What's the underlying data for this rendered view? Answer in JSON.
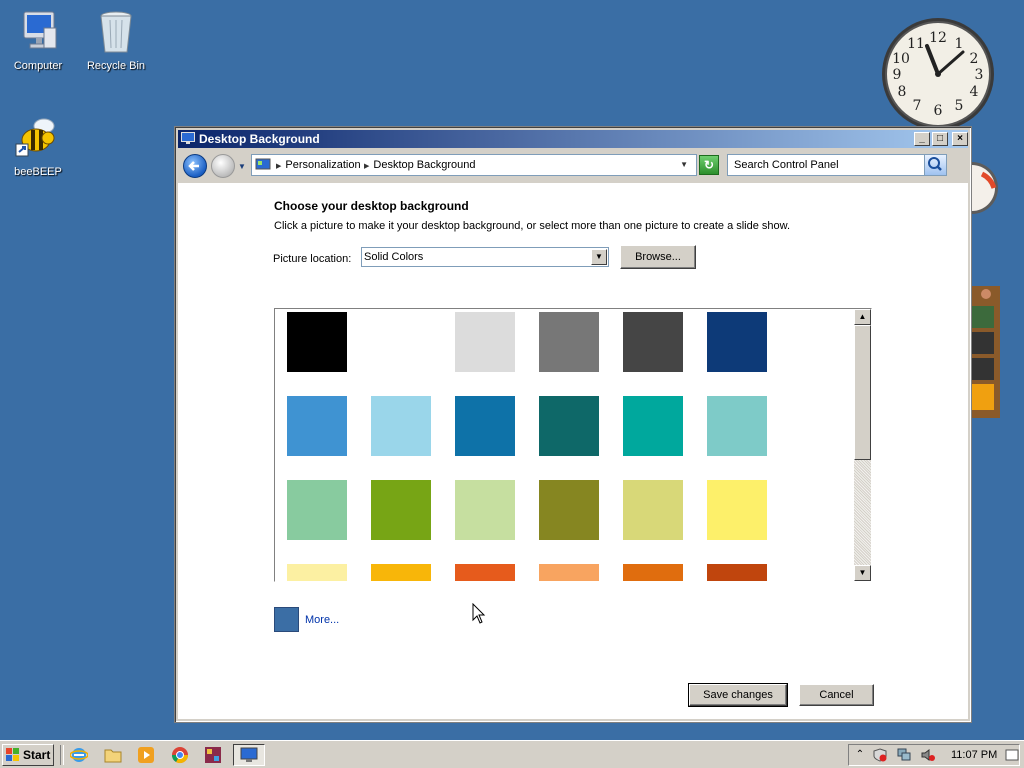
{
  "desktop": {
    "icons": [
      {
        "label": "Computer"
      },
      {
        "label": "Recycle Bin"
      },
      {
        "label": "beeBEEP"
      }
    ],
    "background_color": "#3a6ea5"
  },
  "clock_gadget": {
    "numbers": [
      "12",
      "1",
      "2",
      "3",
      "4",
      "5",
      "6",
      "7",
      "8",
      "9",
      "10",
      "11"
    ]
  },
  "window": {
    "title": "Desktop Background",
    "address": {
      "crumbs": [
        "Personalization",
        "Desktop Background"
      ]
    },
    "search": {
      "placeholder": "Search Control Panel"
    },
    "heading": "Choose your desktop background",
    "instructions": "Click a picture to make it your desktop background, or select more than one picture to create a slide show.",
    "picture_location_label": "Picture location:",
    "picture_location_value": "Solid Colors",
    "browse_label": "Browse...",
    "swatches": [
      [
        "#000000",
        "#ffffff",
        "#dcdcdc",
        "#777777",
        "#454545",
        "#0d3a78"
      ],
      [
        "#3f93d2",
        "#9ad6ea",
        "#0e72a8",
        "#0e6868",
        "#00a89d",
        "#7ecbc8"
      ],
      [
        "#88cb9f",
        "#77a515",
        "#c6dfa0",
        "#868621",
        "#d8d878",
        "#fdf06a"
      ],
      [
        "#fcf0a2",
        "#f8b609",
        "#e65b1c",
        "#f8a460",
        "#e06d0e",
        "#c0450d"
      ]
    ],
    "more_color": "#3b6ea5",
    "more_label": "More...",
    "save_label": "Save changes",
    "cancel_label": "Cancel"
  },
  "taskbar": {
    "start_label": "Start",
    "clock": "11:07 PM"
  }
}
